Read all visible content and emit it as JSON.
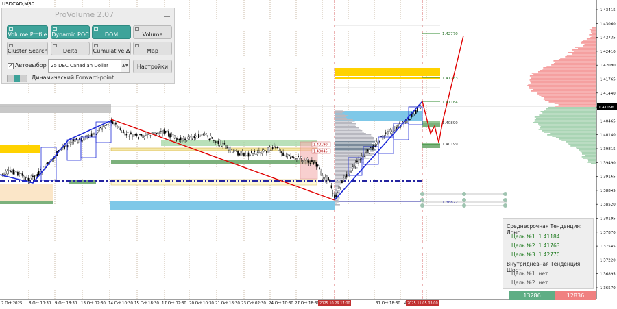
{
  "symbol": "USDCAD,M30",
  "panel": {
    "title": "ProVolume 2.07",
    "buttons": [
      {
        "label": "Volume Profile",
        "active": true
      },
      {
        "label": "Dynamic POC",
        "active": true
      },
      {
        "label": "DOM",
        "active": true
      },
      {
        "label": "Volume",
        "active": false
      },
      {
        "label": "Cluster Search",
        "active": false
      },
      {
        "label": "Delta",
        "active": false
      },
      {
        "label": "Cumulative Δ",
        "active": false
      },
      {
        "label": "Map",
        "active": false
      }
    ],
    "auto_select_label": "Автовыбор",
    "auto_select_checked": true,
    "instrument": "25 DEC Canadian Dollar",
    "settings_button": "Настройки",
    "forward_point_label": "Динамический Forward-point"
  },
  "price_axis": [
    "1.43415",
    "1.43060",
    "1.42735",
    "1.42410",
    "1.42090",
    "1.41765",
    "1.41440",
    "1.40790",
    "1.40465",
    "1.40140",
    "1.39815",
    "1.39490",
    "1.39165",
    "1.38845",
    "1.38520",
    "1.38195",
    "1.37870",
    "1.37545",
    "1.37220",
    "1.36895",
    "1.36570"
  ],
  "current_price": "1.41096",
  "time_axis": [
    "7 Oct 2025",
    "8 Oct 10:30",
    "9 Oct 18:30",
    "13 Oct 02:30",
    "14 Oct 10:30",
    "15 Oct 18:30",
    "17 Oct 02:30",
    "20 Oct 10:30",
    "21 Oct 18:30",
    "23 Oct 02:30",
    "24 Oct 10:30",
    "27 Oct 18:30",
    "31 Oct 18:30",
    "4"
  ],
  "time_markers": [
    "2025.10.29 17:00",
    "2025.11.05 03:00"
  ],
  "level_labels": [
    "1.42770",
    "1.41763",
    "1.41184",
    "1.40890",
    "1.40199",
    "1.38822",
    "1.40190",
    "1.40045"
  ],
  "trend_panel": {
    "medium_title": "Среднесрочная Тенденция: Лонг",
    "medium_targets": [
      "Цель №1:  1.41184",
      "Цель №2:  1.41763",
      "Цель №3:  1.42770"
    ],
    "intraday_title": "Внутридневная Тенденция: Шорт",
    "intraday_targets": [
      "Цель №1:  нет",
      "Цель №2:  нет"
    ]
  },
  "volume_bar": {
    "buy": "13286",
    "sell": "12836",
    "buy_color": "#5fae85",
    "sell_color": "#f08080"
  },
  "colors": {
    "accent": "#3ea39a",
    "bull_line": "#1f2bd8",
    "bear_line": "#e00000",
    "yellow_zone": "#ffd200",
    "blue_zone": "#7ec8e8",
    "green_zone": "#7cb17c"
  }
}
